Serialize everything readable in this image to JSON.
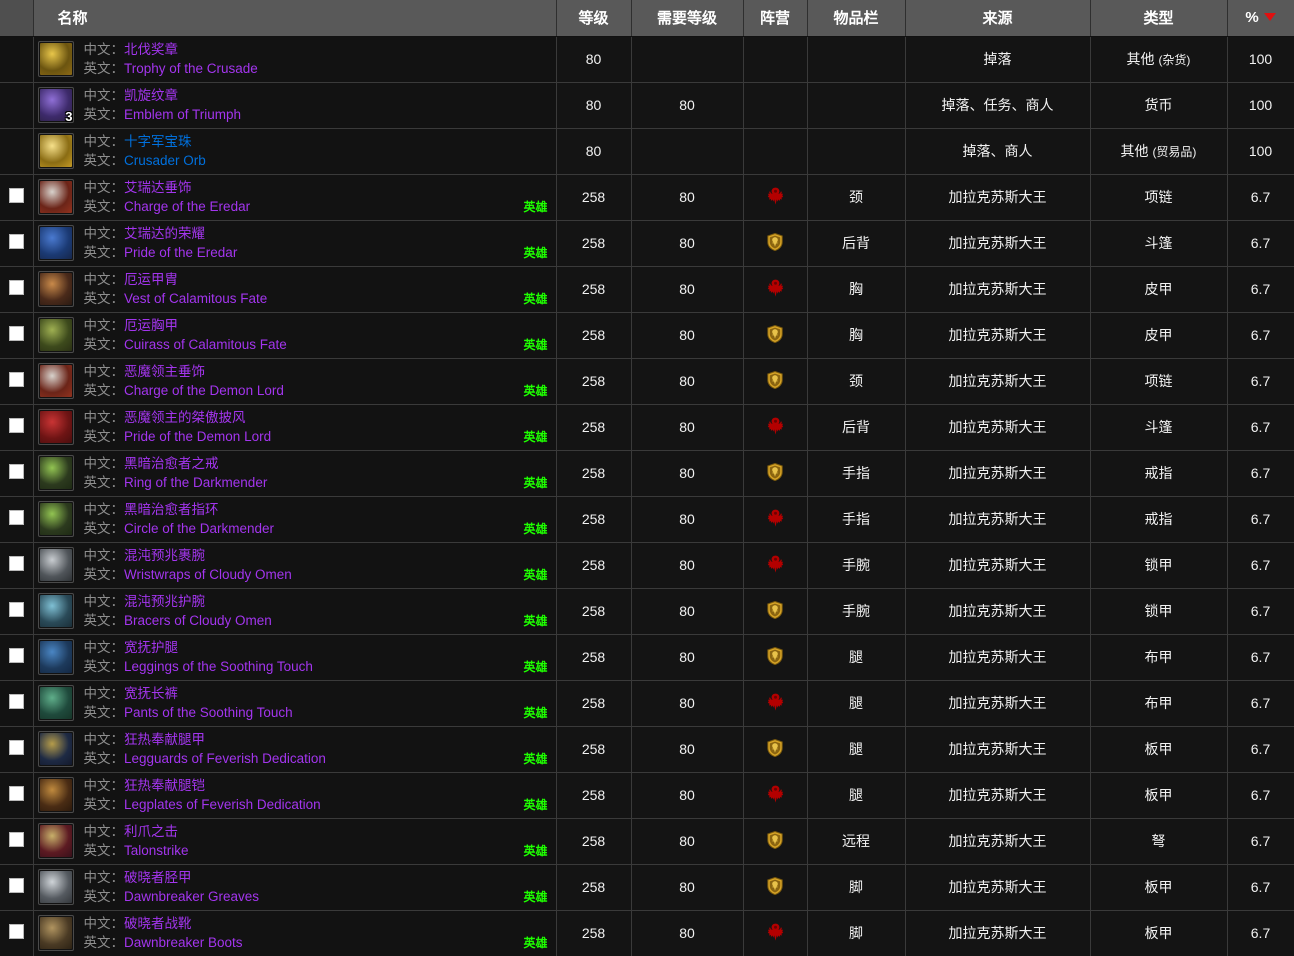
{
  "header": {
    "checkbox_col": "",
    "columns": [
      {
        "key": "name",
        "label": "名称"
      },
      {
        "key": "level",
        "label": "等级"
      },
      {
        "key": "req",
        "label": "需要等级"
      },
      {
        "key": "faction",
        "label": "阵营"
      },
      {
        "key": "slot",
        "label": "物品栏"
      },
      {
        "key": "source",
        "label": "来源"
      },
      {
        "key": "type",
        "label": "类型"
      },
      {
        "key": "pct",
        "label": "%"
      }
    ],
    "sort_column": "%",
    "sort_direction": "desc",
    "sort_icon": "sort-descending-triangle-icon"
  },
  "labels": {
    "cn_prefix": "中文：",
    "en_prefix": "英文：",
    "heroic": "英雄"
  },
  "colors": {
    "epic": "#a335ee",
    "rare": "#0070dd",
    "heroic_green": "#1eff00",
    "header_bg": "#595959",
    "row_bg": "#141414",
    "sort_triangle": "#e01010",
    "horde": "#b40000",
    "alliance": "#d6a326"
  },
  "rows": [
    {
      "checkbox": false,
      "icon": "trophy-of-the-crusade-icon",
      "icon_colors": [
        "#6b5410",
        "#e8c64a",
        "#8d6a16"
      ],
      "stack": "",
      "cn": "北伐奖章",
      "en": "Trophy of the Crusade",
      "quality": "epic",
      "heroic": false,
      "level": "80",
      "req": "",
      "faction": "",
      "slot": "",
      "source": "掉落",
      "type": "其他 (杂货)",
      "pct": "100"
    },
    {
      "checkbox": false,
      "icon": "emblem-of-triumph-icon",
      "icon_colors": [
        "#3d2a6b",
        "#8f6fd6",
        "#2b2140"
      ],
      "stack": "3",
      "cn": "凯旋纹章",
      "en": "Emblem of Triumph",
      "quality": "epic",
      "heroic": false,
      "level": "80",
      "req": "80",
      "faction": "",
      "slot": "",
      "source": "掉落、任务、商人",
      "type": "货币",
      "pct": "100"
    },
    {
      "checkbox": false,
      "icon": "crusader-orb-icon",
      "icon_colors": [
        "#8a6c13",
        "#f6e08a",
        "#c49a26"
      ],
      "stack": "",
      "cn": "十字军宝珠",
      "en": "Crusader Orb",
      "quality": "rare",
      "heroic": false,
      "level": "80",
      "req": "",
      "faction": "",
      "slot": "",
      "source": "掉落、商人",
      "type": "其他 (贸易品)",
      "pct": "100"
    },
    {
      "checkbox": true,
      "icon": "charge-of-the-eredar-icon",
      "icon_colors": [
        "#6b2418",
        "#d8d2cc",
        "#93331f"
      ],
      "stack": "",
      "cn": "艾瑞达垂饰",
      "en": "Charge of the Eredar",
      "quality": "epic",
      "heroic": true,
      "level": "258",
      "req": "80",
      "faction": "horde",
      "slot": "颈",
      "source": "加拉克苏斯大王",
      "type": "项链",
      "pct": "6.7"
    },
    {
      "checkbox": true,
      "icon": "pride-of-the-eredar-icon",
      "icon_colors": [
        "#1b3a74",
        "#4a7ad0",
        "#16264a"
      ],
      "stack": "",
      "cn": "艾瑞达的荣耀",
      "en": "Pride of the Eredar",
      "quality": "epic",
      "heroic": true,
      "level": "258",
      "req": "80",
      "faction": "alliance",
      "slot": "后背",
      "source": "加拉克苏斯大王",
      "type": "斗篷",
      "pct": "6.7"
    },
    {
      "checkbox": true,
      "icon": "vest-of-calamitous-fate-icon",
      "icon_colors": [
        "#4a2a1a",
        "#c98a4a",
        "#2a1a12"
      ],
      "stack": "",
      "cn": "厄运甲胄",
      "en": "Vest of Calamitous Fate",
      "quality": "epic",
      "heroic": true,
      "level": "258",
      "req": "80",
      "faction": "horde",
      "slot": "胸",
      "source": "加拉克苏斯大王",
      "type": "皮甲",
      "pct": "6.7"
    },
    {
      "checkbox": true,
      "icon": "cuirass-of-calamitous-fate-icon",
      "icon_colors": [
        "#3d4a1c",
        "#9fb052",
        "#2a3014"
      ],
      "stack": "",
      "cn": "厄运胸甲",
      "en": "Cuirass of Calamitous Fate",
      "quality": "epic",
      "heroic": true,
      "level": "258",
      "req": "80",
      "faction": "alliance",
      "slot": "胸",
      "source": "加拉克苏斯大王",
      "type": "皮甲",
      "pct": "6.7"
    },
    {
      "checkbox": true,
      "icon": "charge-of-the-demon-lord-icon",
      "icon_colors": [
        "#6b2418",
        "#d8d2cc",
        "#93331f"
      ],
      "stack": "",
      "cn": "恶魔领主垂饰",
      "en": "Charge of the Demon Lord",
      "quality": "epic",
      "heroic": true,
      "level": "258",
      "req": "80",
      "faction": "alliance",
      "slot": "颈",
      "source": "加拉克苏斯大王",
      "type": "项链",
      "pct": "6.7"
    },
    {
      "checkbox": true,
      "icon": "pride-of-the-demon-lord-icon",
      "icon_colors": [
        "#6e1414",
        "#c93434",
        "#4a0e0e"
      ],
      "stack": "",
      "cn": "恶魔领主的桀傲披风",
      "en": "Pride of the Demon Lord",
      "quality": "epic",
      "heroic": true,
      "level": "258",
      "req": "80",
      "faction": "horde",
      "slot": "后背",
      "source": "加拉克苏斯大王",
      "type": "斗篷",
      "pct": "6.7"
    },
    {
      "checkbox": true,
      "icon": "ring-of-the-darkmender-icon",
      "icon_colors": [
        "#2c3a1e",
        "#92c452",
        "#1e2a14"
      ],
      "stack": "",
      "cn": "黑暗治愈者之戒",
      "en": "Ring of the Darkmender",
      "quality": "epic",
      "heroic": true,
      "level": "258",
      "req": "80",
      "faction": "alliance",
      "slot": "手指",
      "source": "加拉克苏斯大王",
      "type": "戒指",
      "pct": "6.7"
    },
    {
      "checkbox": true,
      "icon": "circle-of-the-darkmender-icon",
      "icon_colors": [
        "#2c3a1e",
        "#92c452",
        "#1e2a14"
      ],
      "stack": "",
      "cn": "黑暗治愈者指环",
      "en": "Circle of the Darkmender",
      "quality": "epic",
      "heroic": true,
      "level": "258",
      "req": "80",
      "faction": "horde",
      "slot": "手指",
      "source": "加拉克苏斯大王",
      "type": "戒指",
      "pct": "6.7"
    },
    {
      "checkbox": true,
      "icon": "wristwraps-of-cloudy-omen-icon",
      "icon_colors": [
        "#50555a",
        "#c8ccd0",
        "#2e3236"
      ],
      "stack": "",
      "cn": "混沌预兆裹腕",
      "en": "Wristwraps of Cloudy Omen",
      "quality": "epic",
      "heroic": true,
      "level": "258",
      "req": "80",
      "faction": "horde",
      "slot": "手腕",
      "source": "加拉克苏斯大王",
      "type": "锁甲",
      "pct": "6.7"
    },
    {
      "checkbox": true,
      "icon": "bracers-of-cloudy-omen-icon",
      "icon_colors": [
        "#2a4a58",
        "#7fc0d4",
        "#1a2e38"
      ],
      "stack": "",
      "cn": "混沌预兆护腕",
      "en": "Bracers of Cloudy Omen",
      "quality": "epic",
      "heroic": true,
      "level": "258",
      "req": "80",
      "faction": "alliance",
      "slot": "手腕",
      "source": "加拉克苏斯大王",
      "type": "锁甲",
      "pct": "6.7"
    },
    {
      "checkbox": true,
      "icon": "leggings-of-the-soothing-touch-icon",
      "icon_colors": [
        "#1d3a5c",
        "#4a86c4",
        "#132743"
      ],
      "stack": "",
      "cn": "宽抚护腿",
      "en": "Leggings of the Soothing Touch",
      "quality": "epic",
      "heroic": true,
      "level": "258",
      "req": "80",
      "faction": "alliance",
      "slot": "腿",
      "source": "加拉克苏斯大王",
      "type": "布甲",
      "pct": "6.7"
    },
    {
      "checkbox": true,
      "icon": "pants-of-the-soothing-touch-icon",
      "icon_colors": [
        "#1f4a3c",
        "#5fae8a",
        "#163528"
      ],
      "stack": "",
      "cn": "宽抚长裤",
      "en": "Pants of the Soothing Touch",
      "quality": "epic",
      "heroic": true,
      "level": "258",
      "req": "80",
      "faction": "horde",
      "slot": "腿",
      "source": "加拉克苏斯大王",
      "type": "布甲",
      "pct": "6.7"
    },
    {
      "checkbox": true,
      "icon": "legguards-of-feverish-dedication-icon",
      "icon_colors": [
        "#1e2a44",
        "#b59c4a",
        "#13192c"
      ],
      "stack": "",
      "cn": "狂热奉献腿甲",
      "en": "Legguards of Feverish Dedication",
      "quality": "epic",
      "heroic": true,
      "level": "258",
      "req": "80",
      "faction": "alliance",
      "slot": "腿",
      "source": "加拉克苏斯大王",
      "type": "板甲",
      "pct": "6.7"
    },
    {
      "checkbox": true,
      "icon": "legplates-of-feverish-dedication-icon",
      "icon_colors": [
        "#4a2c14",
        "#c08a3e",
        "#2c1a0c"
      ],
      "stack": "",
      "cn": "狂热奉献腿铠",
      "en": "Legplates of Feverish Dedication",
      "quality": "epic",
      "heroic": true,
      "level": "258",
      "req": "80",
      "faction": "horde",
      "slot": "腿",
      "source": "加拉克苏斯大王",
      "type": "板甲",
      "pct": "6.7"
    },
    {
      "checkbox": true,
      "icon": "talonstrike-icon",
      "icon_colors": [
        "#5c1a22",
        "#c8b06a",
        "#38101a"
      ],
      "stack": "",
      "cn": "利爪之击",
      "en": "Talonstrike",
      "quality": "epic",
      "heroic": true,
      "level": "258",
      "req": "80",
      "faction": "alliance",
      "slot": "远程",
      "source": "加拉克苏斯大王",
      "type": "弩",
      "pct": "6.7"
    },
    {
      "checkbox": true,
      "icon": "dawnbreaker-greaves-icon",
      "icon_colors": [
        "#555a60",
        "#cfd4d8",
        "#33373b"
      ],
      "stack": "",
      "cn": "破晓者胫甲",
      "en": "Dawnbreaker Greaves",
      "quality": "epic",
      "heroic": true,
      "level": "258",
      "req": "80",
      "faction": "alliance",
      "slot": "脚",
      "source": "加拉克苏斯大王",
      "type": "板甲",
      "pct": "6.7"
    },
    {
      "checkbox": true,
      "icon": "dawnbreaker-boots-icon",
      "icon_colors": [
        "#4a3a24",
        "#b09460",
        "#2c2214"
      ],
      "stack": "",
      "cn": "破晓者战靴",
      "en": "Dawnbreaker Boots",
      "quality": "epic",
      "heroic": true,
      "level": "258",
      "req": "80",
      "faction": "horde",
      "slot": "脚",
      "source": "加拉克苏斯大王",
      "type": "板甲",
      "pct": "6.7"
    }
  ]
}
